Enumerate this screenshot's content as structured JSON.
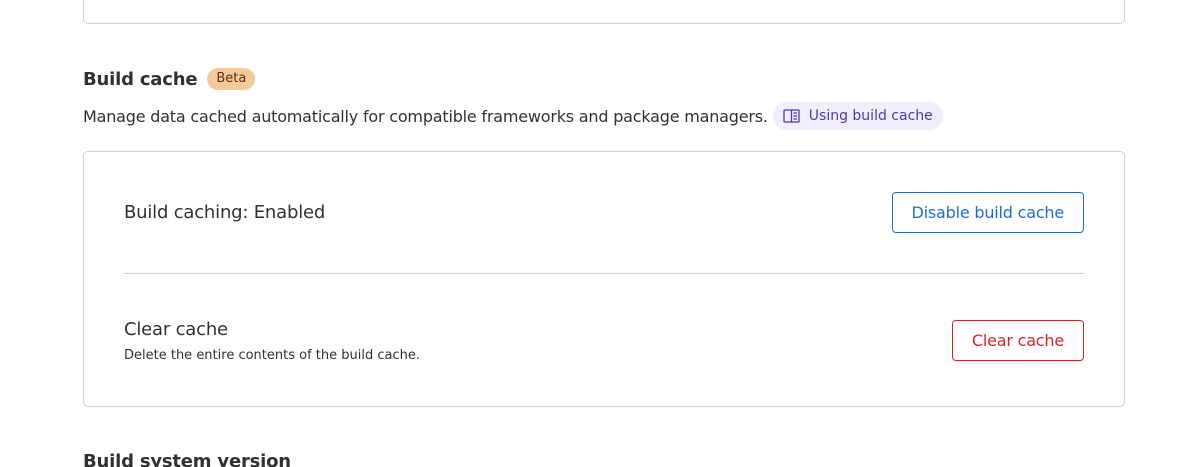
{
  "build_cache": {
    "title": "Build cache",
    "badge": "Beta",
    "description": "Manage data cached automatically for compatible frameworks and package managers.",
    "doc_link": {
      "label": "Using build cache",
      "icon": "book-icon"
    },
    "status_row": {
      "label": "Build caching: Enabled",
      "button_label": "Disable build cache"
    },
    "clear_row": {
      "title": "Clear cache",
      "description": "Delete the entire contents of the build cache.",
      "button_label": "Clear cache"
    }
  },
  "next_section": {
    "title": "Build system version"
  },
  "colors": {
    "badge_bg": "#f7c99a",
    "doc_link_bg": "#f1eefc",
    "doc_link_text": "#4b3bb0",
    "primary": "#1f6fd1",
    "danger": "#d0262a",
    "border": "#cfcfcf"
  }
}
